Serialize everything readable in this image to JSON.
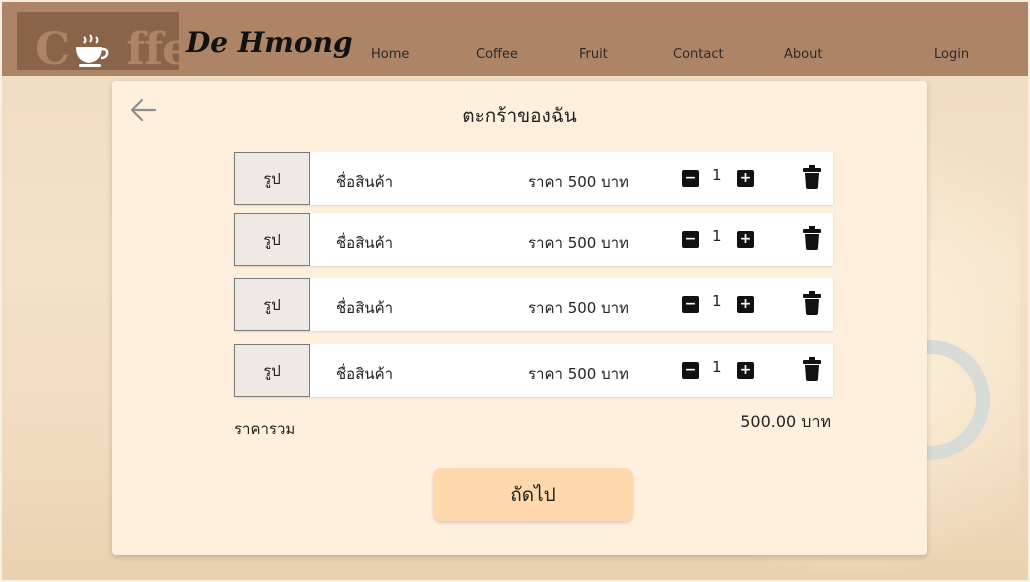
{
  "brand": {
    "logo_word": "Coffee",
    "name": "De Hmong"
  },
  "nav": {
    "home": "Home",
    "coffee": "Coffee",
    "fruit": "Fruit",
    "contact": "Contact",
    "about": "About",
    "login": "Login"
  },
  "cart": {
    "title": "ตะกร้าของฉัน",
    "items": [
      {
        "image_label": "รูป",
        "name": "ชื่อสินค้า",
        "price": "ราคา 500 บาท",
        "qty": "1"
      },
      {
        "image_label": "รูป",
        "name": "ชื่อสินค้า",
        "price": "ราคา 500 บาท",
        "qty": "1"
      },
      {
        "image_label": "รูป",
        "name": "ชื่อสินค้า",
        "price": "ราคา 500 บาท",
        "qty": "1"
      },
      {
        "image_label": "รูป",
        "name": "ชื่อสินค้า",
        "price": "ราคา 500 บาท",
        "qty": "1"
      }
    ],
    "total_label": "ราคารวม",
    "total_value": "500.00 บาท",
    "next_label": "ถัดไป",
    "minus_symbol": "−",
    "plus_symbol": "+"
  },
  "colors": {
    "navbar": "#ad8466",
    "panel": "#fff0de",
    "next_button": "#ffd9ad"
  },
  "icons": [
    "coffee-cup-icon",
    "back-arrow-icon",
    "minus-icon",
    "plus-icon",
    "trash-icon"
  ]
}
